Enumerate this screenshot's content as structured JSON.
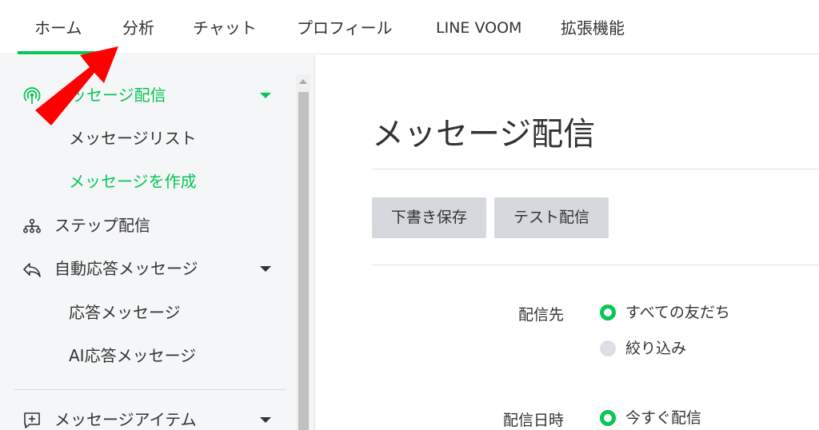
{
  "topnav": {
    "tabs": [
      {
        "label": "ホーム"
      },
      {
        "label": "分析"
      },
      {
        "label": "チャット"
      },
      {
        "label": "プロフィール"
      },
      {
        "label": "LINE VOOM"
      },
      {
        "label": "拡張機能"
      }
    ],
    "active_tab": "ホーム"
  },
  "sidebar": {
    "message_delivery": "メッセージ配信",
    "message_list": "メッセージリスト",
    "create_message": "メッセージを作成",
    "step_delivery": "ステップ配信",
    "auto_reply": "自動応答メッセージ",
    "reply_message": "応答メッセージ",
    "ai_reply": "AI応答メッセージ",
    "message_items": "メッセージアイテム"
  },
  "main": {
    "title": "メッセージ配信",
    "save_draft": "下書き保存",
    "test_send": "テスト配信",
    "recipients": {
      "label": "配信先",
      "options": [
        {
          "label": "すべての友だち",
          "selected": true
        },
        {
          "label": "絞り込み",
          "selected": false
        }
      ]
    },
    "schedule": {
      "label": "配信日時",
      "options": [
        {
          "label": "今すぐ配信",
          "selected": true
        }
      ]
    }
  },
  "colors": {
    "accent": "#06c755",
    "annotation_arrow": "#ff0000"
  }
}
